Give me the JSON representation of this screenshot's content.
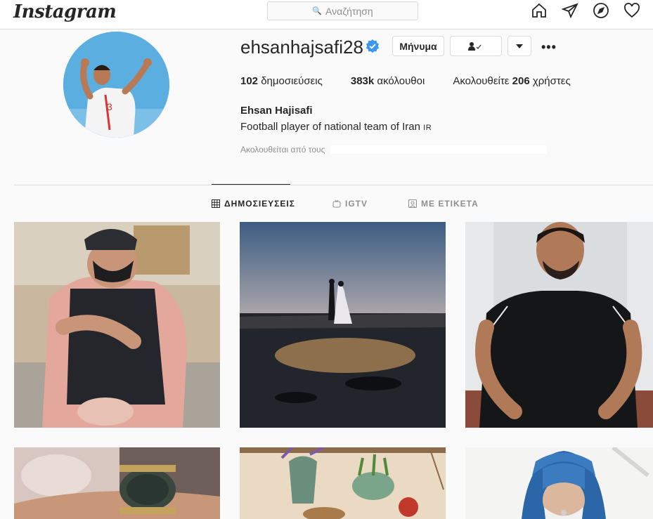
{
  "header": {
    "logo": "Instagram",
    "search_placeholder": "Αναζήτηση",
    "nav_icons": [
      "home-icon",
      "direct-icon",
      "explore-icon",
      "activity-icon"
    ]
  },
  "profile": {
    "username": "ehsanhajsafi28",
    "verified": true,
    "message_button": "Μήνυμα",
    "stats": {
      "posts_count": "102",
      "posts_label": " δημοσιεύσεις",
      "followers_count": "383k",
      "followers_label": " ακόλουθοι",
      "following_prefix": "Ακολουθείτε ",
      "following_count": "206",
      "following_suffix": " χρήστες"
    },
    "full_name": "Ehsan Hajisafi",
    "bio": "Football player of national team of Iran",
    "bio_flag": "IR",
    "followed_by_label": "Ακολουθείται από τους"
  },
  "tabs": [
    {
      "label": "ΔΗΜΟΣΙΕΥΣΕΙΣ",
      "icon": "grid-icon",
      "active": true
    },
    {
      "label": "IGTV",
      "icon": "igtv-icon",
      "active": false
    },
    {
      "label": "ΜΕ ΕΤΙΚΕΤΑ",
      "icon": "tagged-icon",
      "active": false
    }
  ],
  "posts": [
    {
      "description": "father with baby in carrier"
    },
    {
      "description": "wedding couple at sunset by the sea"
    },
    {
      "description": "man in black polo shirt"
    },
    {
      "description": "hand with gold watch"
    },
    {
      "description": "painting of Nowruz haft-sin table"
    },
    {
      "description": "nurse in surgical cap and mask"
    }
  ],
  "colors": {
    "verified_blue": "#3897f0",
    "text": "#262626",
    "muted": "#8e8e8e",
    "border": "#dbdbdb"
  }
}
